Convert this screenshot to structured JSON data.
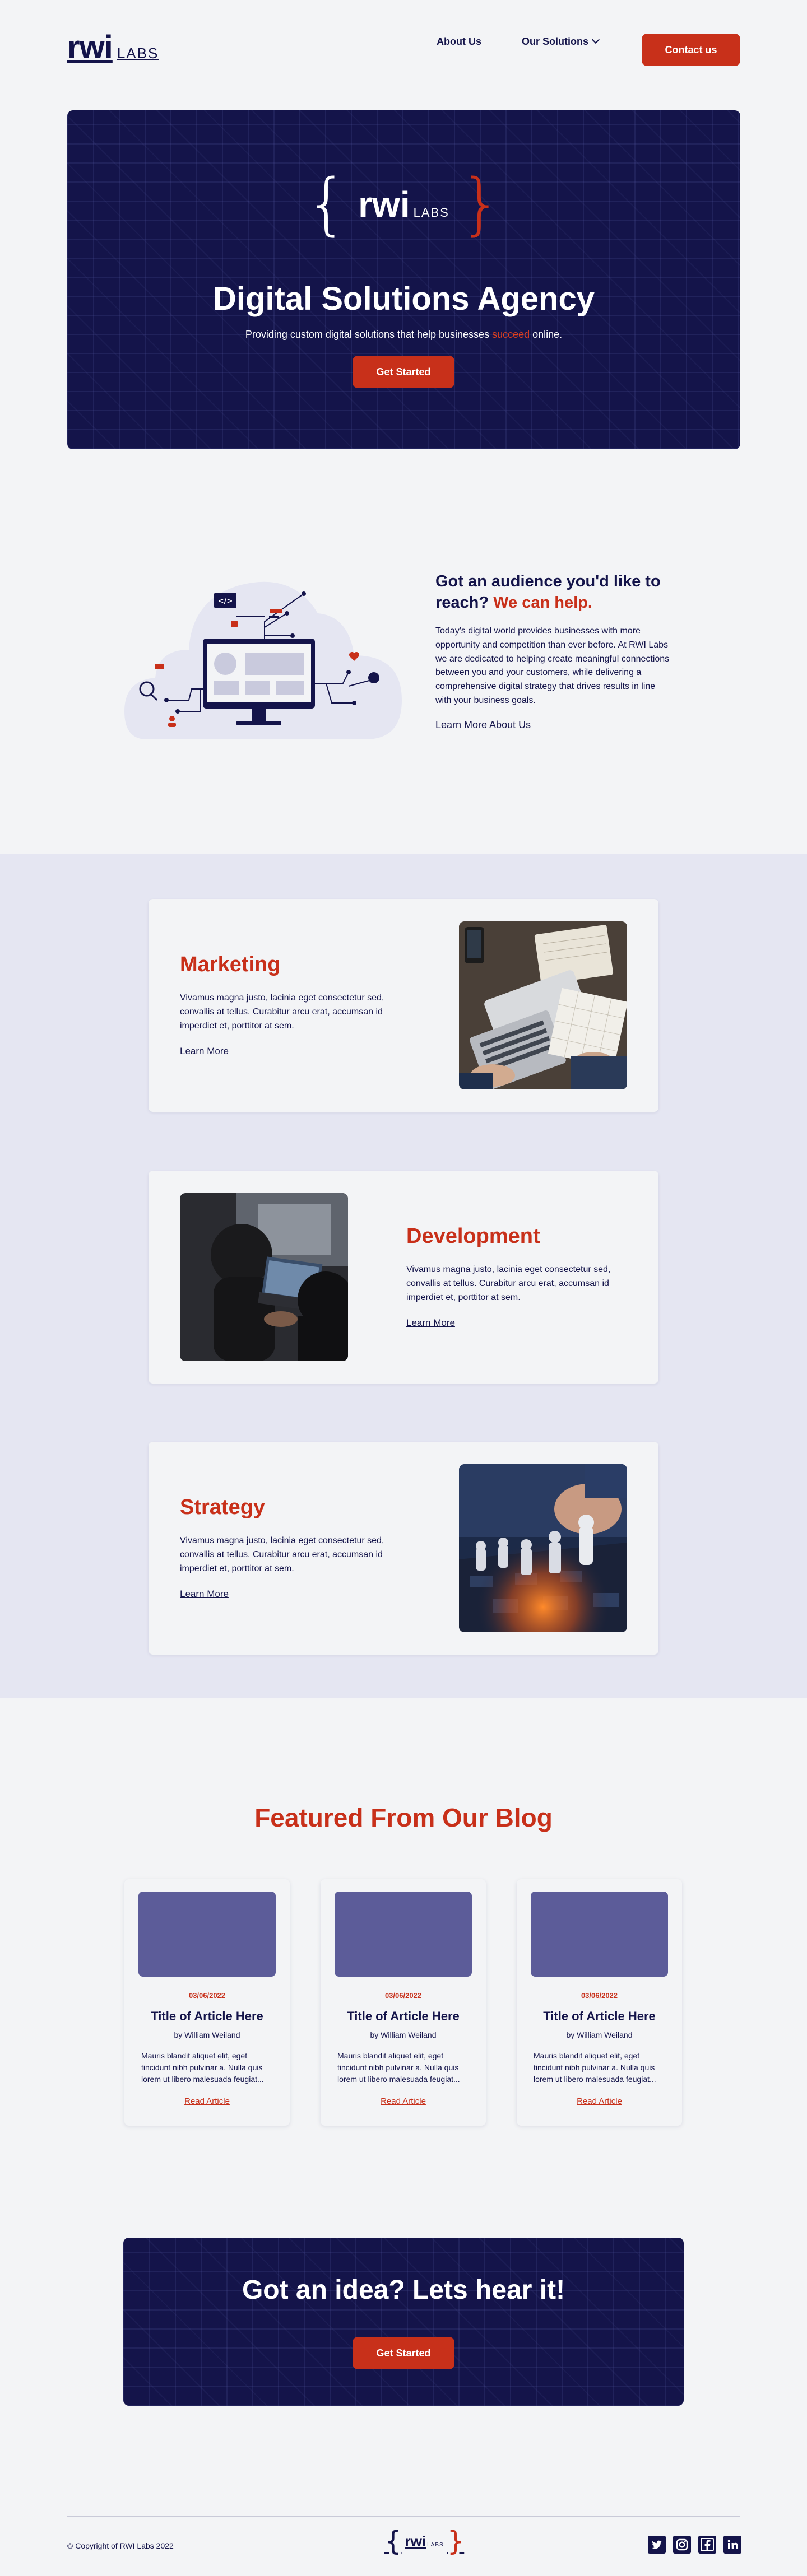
{
  "header": {
    "logo_rwi": "rwi",
    "logo_labs": "LABS",
    "nav": {
      "about": "About Us",
      "solutions": "Our Solutions"
    },
    "contact": "Contact us"
  },
  "hero": {
    "logo_rwi": "rwi",
    "logo_labs": "LABS",
    "brace_left": "{",
    "brace_right": "}",
    "title": "Digital Solutions Agency",
    "subtitle_before": "Providing custom digital solutions that help businesses ",
    "subtitle_accent": "succeed",
    "subtitle_after": " online.",
    "button": "Get Started"
  },
  "about": {
    "title_line": "Got an audience you'd like to reach?",
    "title_accent": "We can help.",
    "body": "Today's digital world provides businesses with more opportunity and competition than ever before. At RWI Labs we are dedicated to helping create meaningful connections between you and your customers, while delivering a comprehensive digital strategy that drives results in line with your business goals.",
    "link": "Learn More About Us",
    "code_icon": "</>"
  },
  "services": [
    {
      "title": "Marketing",
      "body": "Vivamus magna justo, lacinia eget consectetur sed, convallis at tellus. Curabitur arcu erat, accumsan id imperdiet et, porttitor at sem.",
      "link": "Learn More"
    },
    {
      "title": "Development",
      "body": "Vivamus magna justo, lacinia eget consectetur sed, convallis at tellus. Curabitur arcu erat, accumsan id imperdiet et, porttitor at sem.",
      "link": "Learn More"
    },
    {
      "title": "Strategy",
      "body": "Vivamus magna justo, lacinia eget consectetur sed, convallis at tellus. Curabitur arcu erat, accumsan id imperdiet et, porttitor at sem.",
      "link": "Learn More"
    }
  ],
  "blog": {
    "heading": "Featured From Our Blog",
    "posts": [
      {
        "date": "03/06/2022",
        "title": "Title of Article Here",
        "author": "by William Weiland",
        "excerpt": "Mauris blandit aliquet elit, eget tincidunt nibh pulvinar a. Nulla quis lorem ut libero malesuada feugiat...",
        "link": "Read Article"
      },
      {
        "date": "03/06/2022",
        "title": "Title of Article Here",
        "author": "by William Weiland",
        "excerpt": "Mauris blandit aliquet elit, eget tincidunt nibh pulvinar a. Nulla quis lorem ut libero malesuada feugiat...",
        "link": "Read Article"
      },
      {
        "date": "03/06/2022",
        "title": "Title of Article Here",
        "author": "by William Weiland",
        "excerpt": "Mauris blandit aliquet elit, eget tincidunt nibh pulvinar a. Nulla quis lorem ut libero malesuada feugiat...",
        "link": "Read Article"
      }
    ]
  },
  "cta": {
    "title": "Got an idea? Lets hear it!",
    "button": "Get Started"
  },
  "footer": {
    "copyright": "© Copyright of RWI Labs 2022",
    "logo_rwi": "rwi",
    "logo_labs": "LABS",
    "brace_left": "{",
    "brace_right": "}",
    "socials": [
      "twitter-icon",
      "instagram-icon",
      "facebook-icon",
      "linkedin-icon"
    ]
  },
  "colors": {
    "navy": "#14144a",
    "red": "#c8301a",
    "background": "#f3f4f6",
    "lavender": "#e5e6f2",
    "blog_placeholder": "#5c5c99"
  }
}
